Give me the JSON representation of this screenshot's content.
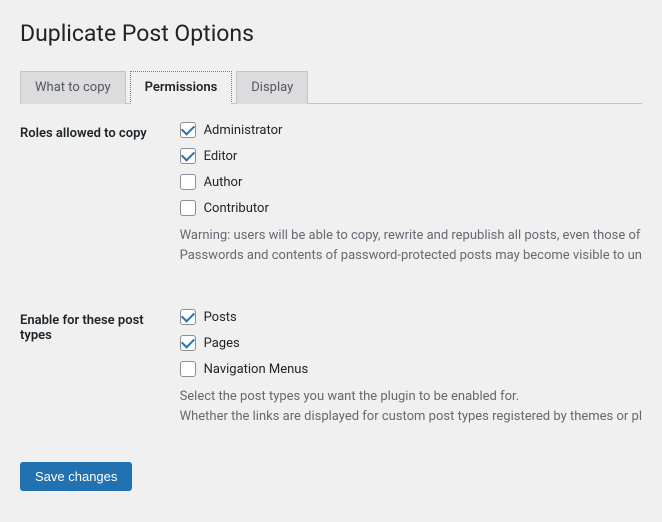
{
  "page": {
    "title": "Duplicate Post Options"
  },
  "tabs": {
    "what_to_copy": "What to copy",
    "permissions": "Permissions",
    "display": "Display"
  },
  "sections": {
    "roles": {
      "heading": "Roles allowed to copy",
      "options": {
        "administrator": "Administrator",
        "editor": "Editor",
        "author": "Author",
        "contributor": "Contributor"
      },
      "warning_line1": "Warning: users will be able to copy, rewrite and republish all posts, even those of",
      "warning_line2": "Passwords and contents of password-protected posts may become visible to un"
    },
    "post_types": {
      "heading": "Enable for these post types",
      "options": {
        "posts": "Posts",
        "pages": "Pages",
        "nav_menus": "Navigation Menus"
      },
      "desc_line1": "Select the post types you want the plugin to be enabled for.",
      "desc_line2": "Whether the links are displayed for custom post types registered by themes or pl"
    }
  },
  "buttons": {
    "save": "Save changes"
  }
}
